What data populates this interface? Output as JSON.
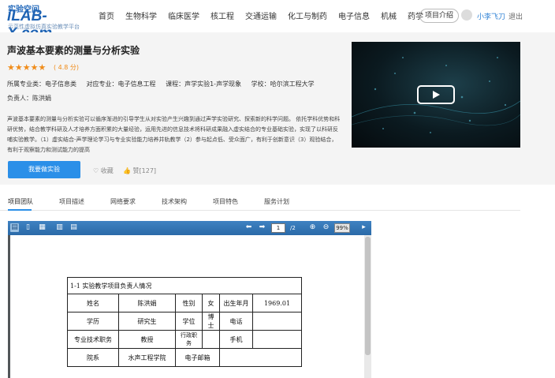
{
  "logo": {
    "top_text": "实验空间",
    "main_text": "iLAB-X.com",
    "sub_text": "示范性虚拟仿真实验教学平台"
  },
  "nav": {
    "items": [
      "首页",
      "生物科学",
      "临床医学",
      "核工程",
      "交通运输",
      "化工与制药",
      "电子信息",
      "机械",
      "药学"
    ],
    "intro_button": "项目介绍",
    "username": "小李飞刀",
    "logout": "退出"
  },
  "project": {
    "title": "声波基本要素的测量与分析实验",
    "stars": "★★★★★",
    "rating": "( 4.8 分)",
    "meta": {
      "major": "所属专业类：电子信息类",
      "specialty": "对应专业：电子信息工程",
      "course": "课程：声学实验1-声学现象",
      "school": "学校：哈尔滨工程大学"
    },
    "owner": "负责人：陈洪娟",
    "description": "声波基本要素的测量与分析实验可以循序渐进的引导学生从对实验产生兴趣到通过声学实验研究、探索新的科学问题。 依托学科优势和科研优势，结合教学科研及人才培养方面积累的大量经验，运用先进的信息技术将科研成果融入虚实结合的专业基础实验，实现了以科研反哺实验教学。（1）虚实结合-声学理论学习与专业实验能力培养并轨教学（2）参与起点低、受众面广，有利于创新意识（3）观验结合，有利于观察能力和测试能力的提高",
    "start_button": "我要做实验",
    "favorite": "收藏",
    "likes": "赞[127]"
  },
  "tabs": [
    "项目团队",
    "项目描述",
    "网络要求",
    "技术架构",
    "项目特色",
    "服务计划"
  ],
  "viewer": {
    "page_current": "1",
    "page_total": "/2",
    "zoom": "99%"
  },
  "doc_table": {
    "caption": "1-1 实验教学项目负责人情况",
    "row1": [
      "姓名",
      "陈洪娟",
      "性别",
      "女",
      "出生年月",
      "1969.01"
    ],
    "row2": [
      "学历",
      "研究生",
      "学位",
      "博士",
      "电话",
      ""
    ],
    "row3": [
      "专业技术职务",
      "教授",
      "行政职务",
      "",
      "手机",
      ""
    ],
    "row4": [
      "院系",
      "水声工程学院",
      "电子邮箱",
      ""
    ]
  },
  "colors": {
    "accent": "#2b8fe8",
    "star": "#f08c1a",
    "toolbar": "#2a6aa8"
  }
}
